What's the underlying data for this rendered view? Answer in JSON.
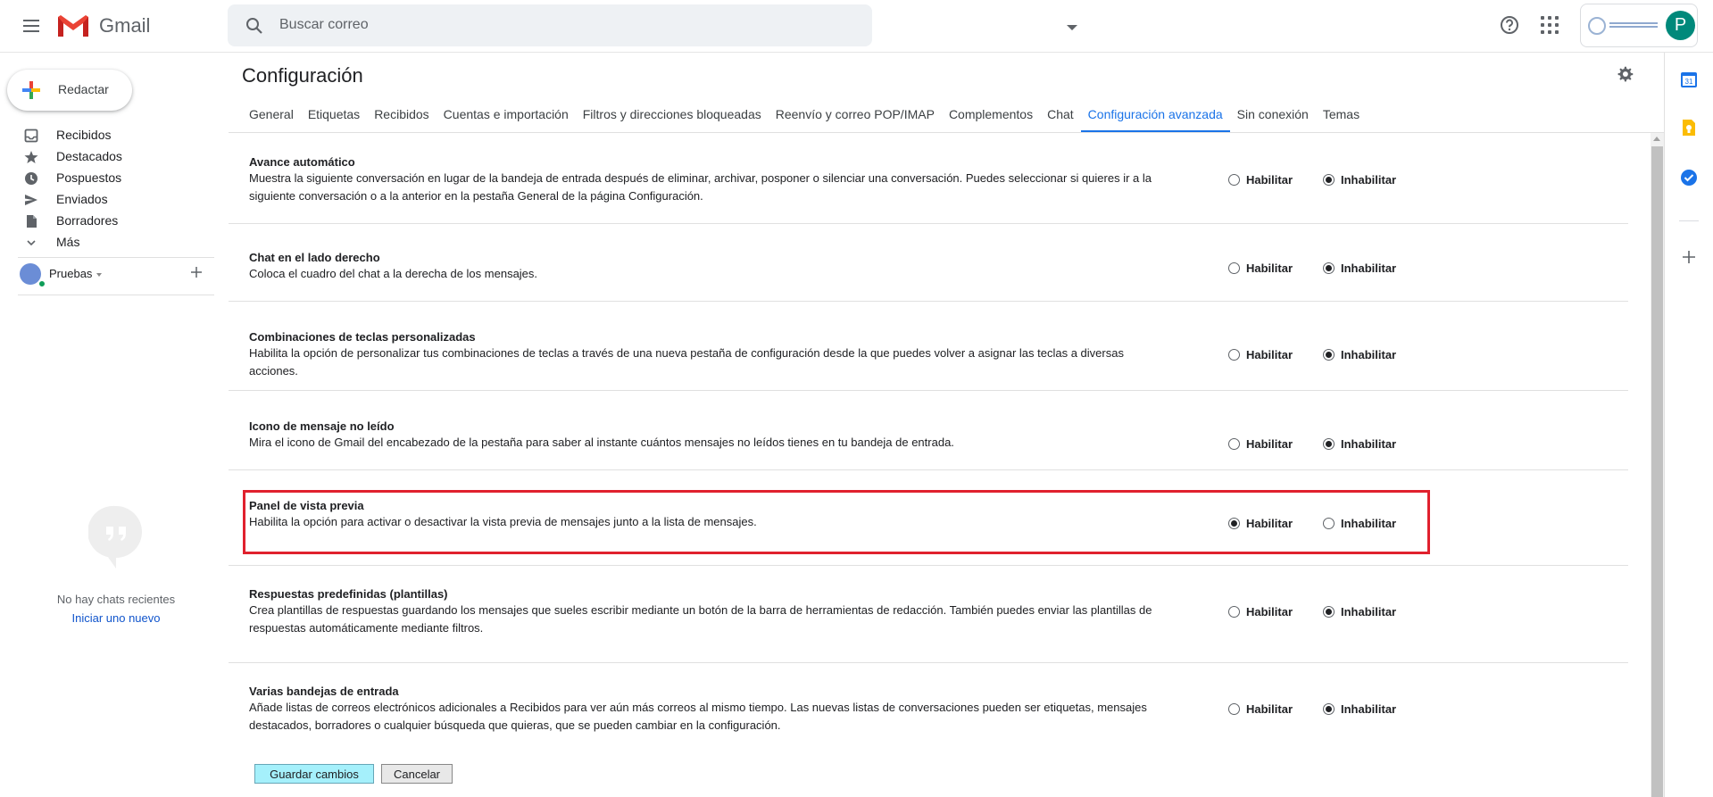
{
  "topbar": {
    "brand": "Gmail",
    "search_placeholder": "Buscar correo",
    "avatar_letter": "P"
  },
  "compose": {
    "label": "Redactar"
  },
  "nav": [
    {
      "label": "Recibidos",
      "icon": "inbox-icon"
    },
    {
      "label": "Destacados",
      "icon": "star-icon"
    },
    {
      "label": "Pospuestos",
      "icon": "clock-icon"
    },
    {
      "label": "Enviados",
      "icon": "send-icon"
    },
    {
      "label": "Borradores",
      "icon": "draft-icon"
    },
    {
      "label": "Más",
      "icon": "chevron-down-icon"
    }
  ],
  "hangouts": {
    "user": "Pruebas",
    "no_chats": "No hay chats recientes",
    "start_new": "Iniciar uno nuevo"
  },
  "page": {
    "title": "Configuración"
  },
  "tabs": [
    {
      "label": "General",
      "active": false
    },
    {
      "label": "Etiquetas",
      "active": false
    },
    {
      "label": "Recibidos",
      "active": false
    },
    {
      "label": "Cuentas e importación",
      "active": false
    },
    {
      "label": "Filtros y direcciones bloqueadas",
      "active": false
    },
    {
      "label": "Reenvío y correo POP/IMAP",
      "active": false
    },
    {
      "label": "Complementos",
      "active": false
    },
    {
      "label": "Chat",
      "active": false
    },
    {
      "label": "Configuración avanzada",
      "active": true
    },
    {
      "label": "Sin conexión",
      "active": false
    },
    {
      "label": "Temas",
      "active": false
    }
  ],
  "options": {
    "enable": "Habilitar",
    "disable": "Inhabilitar"
  },
  "settings": [
    {
      "title": "Avance automático",
      "description": "Muestra la siguiente conversación en lugar de la bandeja de entrada después de eliminar, archivar, posponer o silenciar una conversación. Puedes seleccionar si quieres ir a la siguiente conversación o a la anterior en la pestaña General de la página Configuración.",
      "value": "disable"
    },
    {
      "title": "Chat en el lado derecho",
      "description": "Coloca el cuadro del chat a la derecha de los mensajes.",
      "value": "disable"
    },
    {
      "title": "Combinaciones de teclas personalizadas",
      "description": "Habilita la opción de personalizar tus combinaciones de teclas a través de una nueva pestaña de configuración desde la que puedes volver a asignar las teclas a diversas acciones.",
      "value": "disable"
    },
    {
      "title": "Icono de mensaje no leído",
      "description": "Mira el icono de Gmail del encabezado de la pestaña para saber al instante cuántos mensajes no leídos tienes en tu bandeja de entrada.",
      "value": "disable"
    },
    {
      "title": "Panel de vista previa",
      "description": "Habilita la opción para activar o desactivar la vista previa de mensajes junto a la lista de mensajes.",
      "value": "enable",
      "highlighted": true
    },
    {
      "title": "Respuestas predefinidas (plantillas)",
      "description": "Crea plantillas de respuestas guardando los mensajes que sueles escribir mediante un botón de la barra de herramientas de redacción. También puedes enviar las plantillas de respuestas automáticamente mediante filtros.",
      "value": "disable"
    },
    {
      "title": "Varias bandejas de entrada",
      "description": "Añade listas de correos electrónicos adicionales a Recibidos para ver aún más correos al mismo tiempo. Las nuevas listas de conversaciones pueden ser etiquetas, mensajes destacados, borradores o cualquier búsqueda que quieras, que se pueden cambiar en la configuración.",
      "value": "disable"
    }
  ],
  "buttons": {
    "save": "Guardar cambios",
    "cancel": "Cancelar"
  },
  "colors": {
    "accent": "#1a73e8",
    "highlight_border": "#e0212e",
    "save_button": "#a5f0fb"
  },
  "side_panel": [
    "calendar-icon",
    "keep-icon",
    "tasks-icon",
    "add-icon"
  ]
}
